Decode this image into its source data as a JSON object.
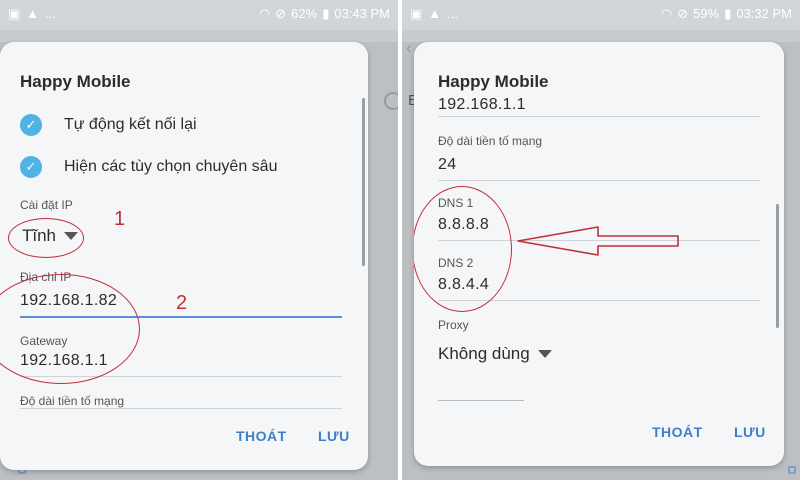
{
  "left": {
    "status": {
      "left_icons": [
        "image-icon",
        "warning-icon"
      ],
      "dots": "...",
      "battery": "62%",
      "time": "03:43 PM"
    },
    "dialog": {
      "title": "Happy Mobile",
      "checks": [
        {
          "label": "Tự động kết nối lại"
        },
        {
          "label": "Hiện các tùy chọn chuyên sâu"
        }
      ],
      "ip_settings": {
        "label": "Cài đặt IP",
        "value": "Tĩnh"
      },
      "ip_address": {
        "label": "Địa chỉ IP",
        "value": "192.168.1.82"
      },
      "gateway": {
        "label": "Gateway",
        "value": "192.168.1.1"
      },
      "prefix": {
        "label": "Độ dài tiền tố mạng"
      },
      "cancel": "THOÁT",
      "save": "LƯU"
    },
    "annotations": {
      "n1": "1",
      "n2": "2"
    }
  },
  "right": {
    "status": {
      "left_icons": [
        "image-icon",
        "warning-icon"
      ],
      "dots": "...",
      "battery": "59%",
      "time": "03:32 PM"
    },
    "background": {
      "label": "E"
    },
    "dialog": {
      "title": "Happy Mobile",
      "partial_value": "192.168.1.1",
      "prefix": {
        "label": "Độ dài tiền tố mạng",
        "value": "24"
      },
      "dns1": {
        "label": "DNS 1",
        "value": "8.8.8.8"
      },
      "dns2": {
        "label": "DNS 2",
        "value": "8.8.4.4"
      },
      "proxy": {
        "label": "Proxy",
        "value": "Không dùng"
      },
      "cancel": "THOÁT",
      "save": "LƯU"
    }
  },
  "colors": {
    "accent": "#4fb3e3",
    "button": "#3f7fc8",
    "annotation": "#c0303a",
    "active_line": "#5b8fd8"
  }
}
